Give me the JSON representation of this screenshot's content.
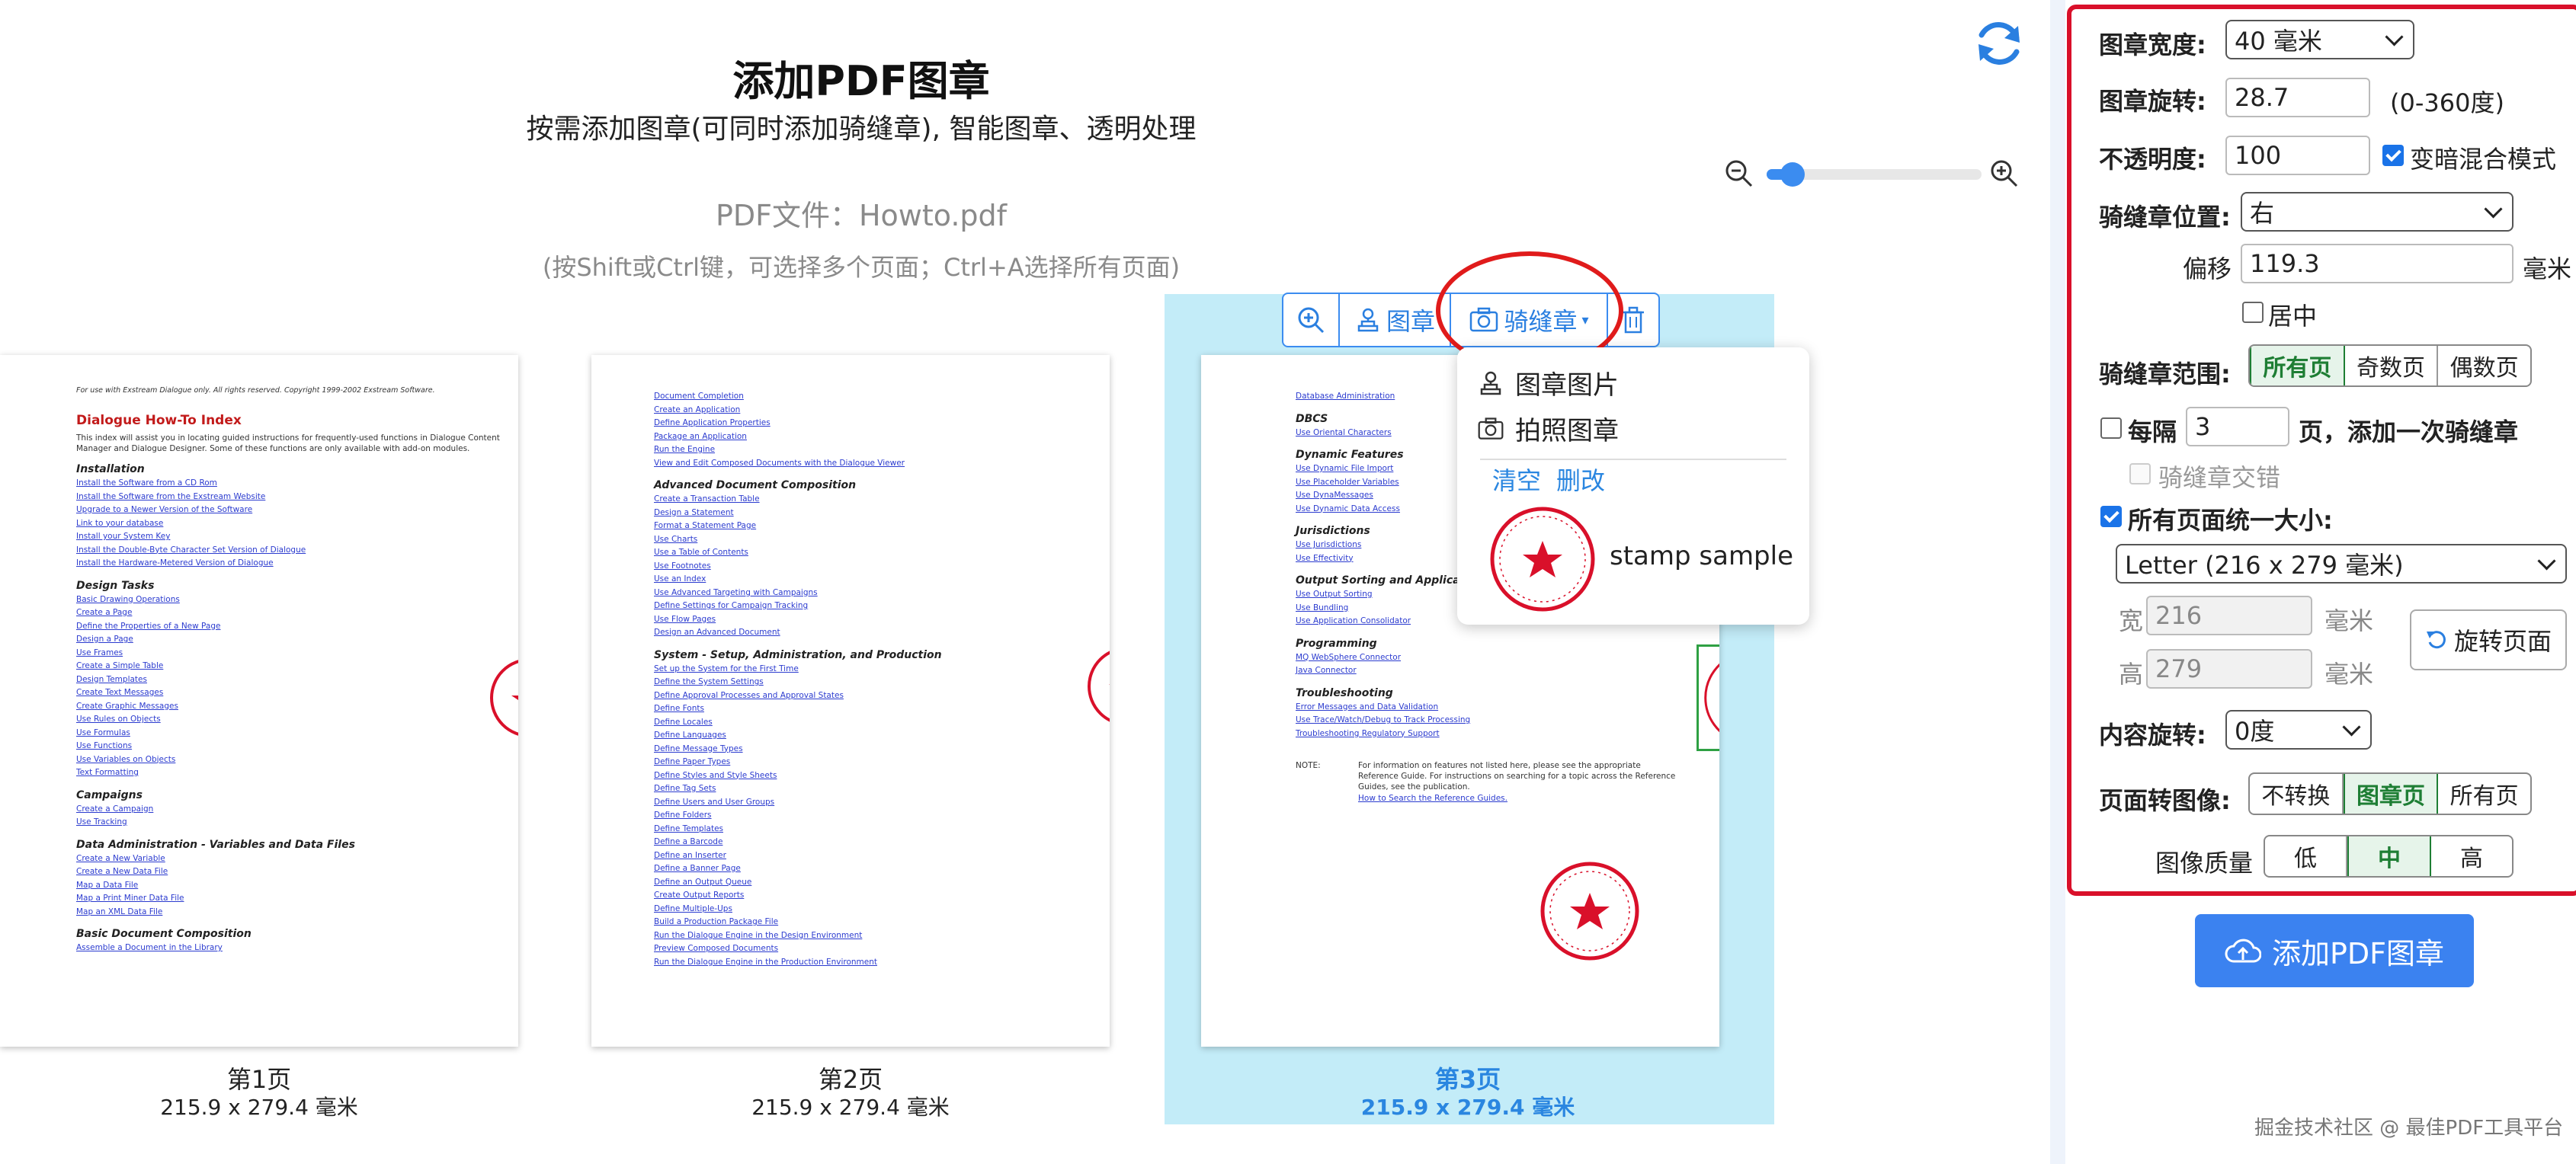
{
  "header": {
    "title": "添加PDF图章",
    "subtitle": "按需添加图章(可同时添加骑缝章), 智能图章、透明处理",
    "pdf_file": "PDF文件：Howto.pdf",
    "hint": "(按Shift或Ctrl键，可选择多个页面；Ctrl+A选择所有页面)"
  },
  "zoom": {
    "level_fraction": 0.12
  },
  "pages": [
    {
      "label": "第1页",
      "size": "215.9 x 279.4 毫米",
      "selected": false
    },
    {
      "label": "第2页",
      "size": "215.9 x 279.4 毫米",
      "selected": false
    },
    {
      "label": "第3页",
      "size": "215.9 x 279.4 毫米",
      "selected": true
    }
  ],
  "page1": {
    "copyright": "For use with Exstream Dialogue only. All rights reserved. Copyright 1999-2002 Exstream Software.",
    "heading": "Dialogue How-To Index",
    "intro": "This index will assist you in locating guided instructions for frequently-used functions in Dialogue Content Manager and Dialogue Designer. Some of these functions are only available with add-on modules.",
    "sections": [
      {
        "title": "Installation",
        "links": [
          "Install the Software from a CD Rom",
          "Install the Software from the Exstream Website",
          "Upgrade to a Newer Version of the Software",
          "Link to your database",
          "Install your System Key",
          "Install the Double-Byte Character Set Version of Dialogue",
          "Install the Hardware-Metered Version of Dialogue"
        ]
      },
      {
        "title": "Design Tasks",
        "links": [
          "Basic Drawing Operations",
          "Create a Page",
          "Define the Properties of a New Page",
          "Design a Page",
          "Use Frames",
          "Create a Simple Table",
          "Design Templates",
          "Create Text Messages",
          "Create Graphic Messages",
          "Use Rules on Objects",
          "Use Formulas",
          "Use Functions",
          "Use Variables on Objects",
          "Text Formatting"
        ]
      },
      {
        "title": "Campaigns",
        "links": [
          "Create a Campaign",
          "Use Tracking"
        ]
      },
      {
        "title": "Data Administration - Variables and Data Files",
        "links": [
          "Create a New Variable",
          "Create a New Data File",
          "Map a Data File",
          "Map a Print Miner Data File",
          "Map an XML Data File"
        ]
      },
      {
        "title": "Basic Document Composition",
        "links": [
          "Assemble a Document in the Library"
        ]
      }
    ]
  },
  "page2": {
    "top_links": [
      "Document Completion",
      "Create an Application",
      "Define Application Properties",
      "Package an Application",
      "Run the Engine",
      "View and Edit Composed Documents with the Dialogue Viewer"
    ],
    "sections": [
      {
        "title": "Advanced Document Composition",
        "links": [
          "Create a Transaction Table",
          "Design a Statement",
          "Format a Statement Page",
          "Use Charts",
          "Use a Table of Contents",
          "Use Footnotes",
          "Use an Index",
          "Use Advanced Targeting with Campaigns",
          "Define Settings for Campaign Tracking",
          "Use Flow Pages",
          "Design an Advanced Document"
        ]
      },
      {
        "title": "System - Setup, Administration, and Production",
        "links": [
          "Set up the System for the First Time",
          "Define the System Settings",
          "Define Approval Processes and Approval States",
          "Define Fonts",
          "Define Locales",
          "Define Languages",
          "Define Message Types",
          "Define Paper Types",
          "Define Styles and Style Sheets",
          "Define Tag Sets",
          "Define Users and User Groups",
          "Define Folders",
          "Define Templates",
          "Define a Barcode",
          "Define an Inserter",
          "Define a Banner Page",
          "Define an Output Queue",
          "Create Output Reports",
          "Define Multiple-Ups",
          "Build a Production Package File",
          "Run the Dialogue Engine in the Design Environment",
          "Preview Composed Documents",
          "Run the Dialogue Engine in the Production Environment"
        ]
      }
    ]
  },
  "page3": {
    "top_links": [
      "Database Administration"
    ],
    "sections": [
      {
        "title": "DBCS",
        "links": [
          "Use Oriental Characters"
        ]
      },
      {
        "title": "Dynamic Features",
        "links": [
          "Use Dynamic File Import",
          "Use Placeholder Variables",
          "Use DynaMessages",
          "Use Dynamic Data Access"
        ]
      },
      {
        "title": "Jurisdictions",
        "links": [
          "Use Jurisdictions",
          "Use Effectivity"
        ]
      },
      {
        "title": "Output Sorting and Application",
        "links": [
          "Use Output Sorting",
          "Use Bundling",
          "Use Application Consolidator"
        ]
      },
      {
        "title": "Programming",
        "links": [
          "MQ WebSphere Connector",
          "Java Connector"
        ]
      },
      {
        "title": "Troubleshooting",
        "links": [
          "Error Messages and Data Validation",
          "Use Trace/Watch/Debug to Track Processing",
          "Troubleshooting Regulatory Support"
        ]
      }
    ],
    "note_label": "NOTE:",
    "note_text": "For information on features not listed here, please see the appropriate Reference Guide. For instructions on searching for a topic across the Reference Guides, see the publication.",
    "note_link": "How to Search the Reference Guides."
  },
  "toolbar": {
    "zoom_icon": "zoom-in-icon",
    "stamp_label": "图章",
    "seam_label": "骑缝章",
    "delete_icon": "trash-icon"
  },
  "dropdown": {
    "item1": "图章图片",
    "item2": "拍照图章",
    "clear": "清空",
    "edit": "删改",
    "stamp_name": "stamp sample"
  },
  "panel": {
    "width_label": "图章宽度:",
    "width_value": "40 毫米",
    "rotate_label": "图章旋转:",
    "rotate_value": "28.7",
    "rotate_range": "(0-360度)",
    "opacity_label": "不透明度:",
    "opacity_value": "100",
    "blend_label": "变暗混合模式",
    "seam_pos_label": "骑缝章位置:",
    "seam_pos_value": "右",
    "offset_label": "偏移",
    "offset_value": "119.3",
    "offset_unit": "毫米",
    "center_label": "居中",
    "range_label": "骑缝章范围:",
    "range_options": [
      "所有页",
      "奇数页",
      "偶数页"
    ],
    "every_label": "每隔",
    "every_value": "3",
    "every_suffix": "页，添加一次骑缝章",
    "alternate_label": "骑缝章交错",
    "uniform_label": "所有页面统一大小:",
    "paper_value": "Letter (216 x 279 毫米)",
    "w_label": "宽",
    "w_value": "216",
    "h_label": "高",
    "h_value": "279",
    "mm": "毫米",
    "rotate_page_label": "旋转页面",
    "content_rot_label": "内容旋转:",
    "content_rot_value": "0度",
    "to_image_label": "页面转图像:",
    "to_image_options": [
      "不转换",
      "图章页",
      "所有页"
    ],
    "quality_label": "图像质量",
    "quality_options": [
      "低",
      "中",
      "高"
    ]
  },
  "add_button": "添加PDF图章",
  "footer": "掘金技术社区 @ 最佳PDF工具平台",
  "colors": {
    "accent": "#3b82f0",
    "stamp_red": "#d9102a",
    "selected_bg": "#c3ecf8",
    "seg_green": "#1e7e34"
  }
}
